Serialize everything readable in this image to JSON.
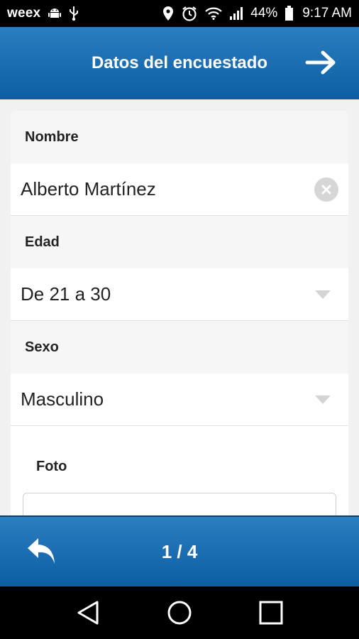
{
  "status_bar": {
    "carrier": "weex",
    "battery": "44%",
    "time": "9:17 AM",
    "icons": [
      "android-icon",
      "usb-icon",
      "location-icon",
      "alarm-icon",
      "wifi-icon",
      "signal-icon",
      "battery-icon"
    ]
  },
  "header": {
    "title": "Datos del encuestado",
    "next_icon": "arrow-right-icon",
    "color": "#1a6db3"
  },
  "form": {
    "nombre": {
      "label": "Nombre",
      "value": "Alberto Martínez"
    },
    "edad": {
      "label": "Edad",
      "value": "De 21 a 30"
    },
    "sexo": {
      "label": "Sexo",
      "value": "Masculino"
    },
    "foto": {
      "label": "Foto"
    }
  },
  "footer": {
    "page_indicator": "1 / 4",
    "back_icon": "reply-arrow-icon"
  },
  "nav": {
    "icons": [
      "back-triangle-icon",
      "home-circle-icon",
      "recents-square-icon"
    ]
  }
}
